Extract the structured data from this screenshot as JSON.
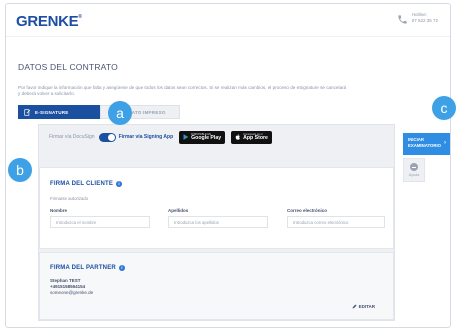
{
  "header": {
    "logo": "GRENKE",
    "logo_mark": "®",
    "phone_label": "Hotline:",
    "phone_number": "07 622 35 72"
  },
  "page": {
    "title": "DATOS DEL CONTRATO",
    "description": "Por favor indique la información que falta y asegúrese de que todos los datos sean correctos. Si se realizan más cambios, el proceso de eSignature se cancelará y deberá volver a solicitarlo."
  },
  "tabs": [
    {
      "label": "E-SIGNATURE",
      "active": true
    },
    {
      "label": "CONTRATO IMPRESO",
      "active": false
    }
  ],
  "signing": {
    "docusign_label": "Firmar vía DocuSign",
    "app_label": "Firmar vía Signing App",
    "toggle_on": true,
    "google_play": {
      "small": "DISPONIBLE EN",
      "big": "Google Play"
    },
    "app_store": {
      "small": "Consíguelo en el",
      "big": "App Store"
    }
  },
  "client": {
    "title": "FIRMA DEL CLIENTE",
    "subtitle": "Firmante autorizado",
    "fields": [
      {
        "label": "Nombre",
        "placeholder": "Introduzca el nombre"
      },
      {
        "label": "Apellidos",
        "placeholder": "Introduzca los apellidos"
      },
      {
        "label": "Correo electrónico",
        "placeholder": "Introduzca correo electrónico"
      }
    ]
  },
  "partner": {
    "title": "FIRMA DEL PARTNER",
    "name": "Stephan TEST",
    "phone": "+4915158564154",
    "email": "someone@grenke.de",
    "edit_label": "EDITAR"
  },
  "sidebar": {
    "init_button": "INICIAR EXAMINATORIO",
    "help_label": "Ayuda"
  },
  "callouts": [
    "a",
    "b",
    "c"
  ],
  "colors": {
    "brand": "#1b4fa0",
    "accent": "#2f8de4",
    "callout": "#3ea0e5"
  }
}
